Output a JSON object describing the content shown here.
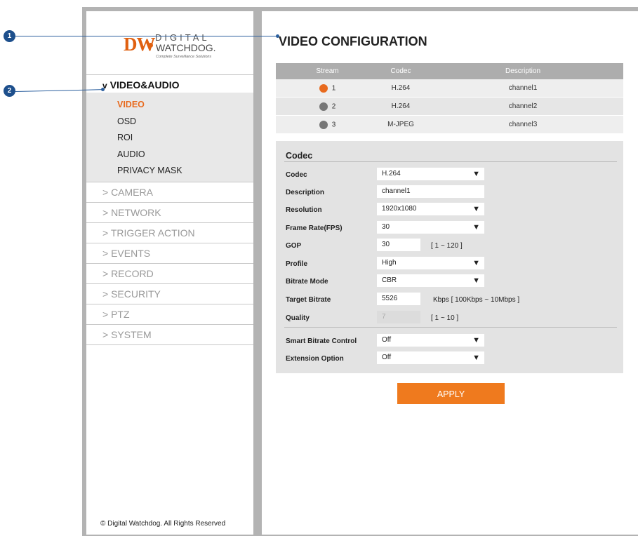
{
  "brand": {
    "logo_dw": "DW",
    "logo_digital": "DIGITAL",
    "logo_watchdog": "WATCHDOG.",
    "logo_tagline": "Complete Surveillance Solutions"
  },
  "sidebar": {
    "section_label": "VIDEO&AUDIO",
    "section_chevron": "v",
    "subitems": [
      "VIDEO",
      "OSD",
      "ROI",
      "AUDIO",
      "PRIVACY MASK"
    ],
    "active_subitem": "VIDEO",
    "menu": [
      "> CAMERA",
      "> NETWORK",
      "> TRIGGER ACTION",
      "> EVENTS",
      "> RECORD",
      "> SECURITY",
      "> PTZ",
      "> SYSTEM"
    ],
    "copyright": "© Digital Watchdog. All Rights Reserved"
  },
  "main": {
    "title": "VIDEO CONFIGURATION",
    "stream_table": {
      "headers": [
        "Stream",
        "Codec",
        "Description"
      ],
      "rows": [
        {
          "stream": "1",
          "codec": "H.264",
          "description": "channel1",
          "selected": true
        },
        {
          "stream": "2",
          "codec": "H.264",
          "description": "channel2",
          "selected": false
        },
        {
          "stream": "3",
          "codec": "M-JPEG",
          "description": "channel3",
          "selected": false
        }
      ]
    },
    "codec_panel": {
      "title": "Codec",
      "codec_label": "Codec",
      "codec_value": "H.264",
      "description_label": "Description",
      "description_value": "channel1",
      "resolution_label": "Resolution",
      "resolution_value": "1920x1080",
      "framerate_label": "Frame Rate(FPS)",
      "framerate_value": "30",
      "gop_label": "GOP",
      "gop_value": "30",
      "gop_range": "[ 1 ~ 120 ]",
      "profile_label": "Profile",
      "profile_value": "High",
      "bitrate_mode_label": "Bitrate Mode",
      "bitrate_mode_value": "CBR",
      "target_bitrate_label": "Target Bitrate",
      "target_bitrate_value": "5526",
      "target_bitrate_range": "Kbps [ 100Kbps ~ 10Mbps ]",
      "quality_label": "Quality",
      "quality_value": "7",
      "quality_range": "[ 1 ~ 10 ]",
      "smart_bitrate_label": "Smart Bitrate Control",
      "smart_bitrate_value": "Off",
      "extension_label": "Extension Option",
      "extension_value": "Off"
    },
    "apply_label": "APPLY"
  },
  "callouts": [
    "1",
    "2"
  ],
  "colors": {
    "accent": "#e86a1e",
    "callout": "#1d4f8c"
  }
}
